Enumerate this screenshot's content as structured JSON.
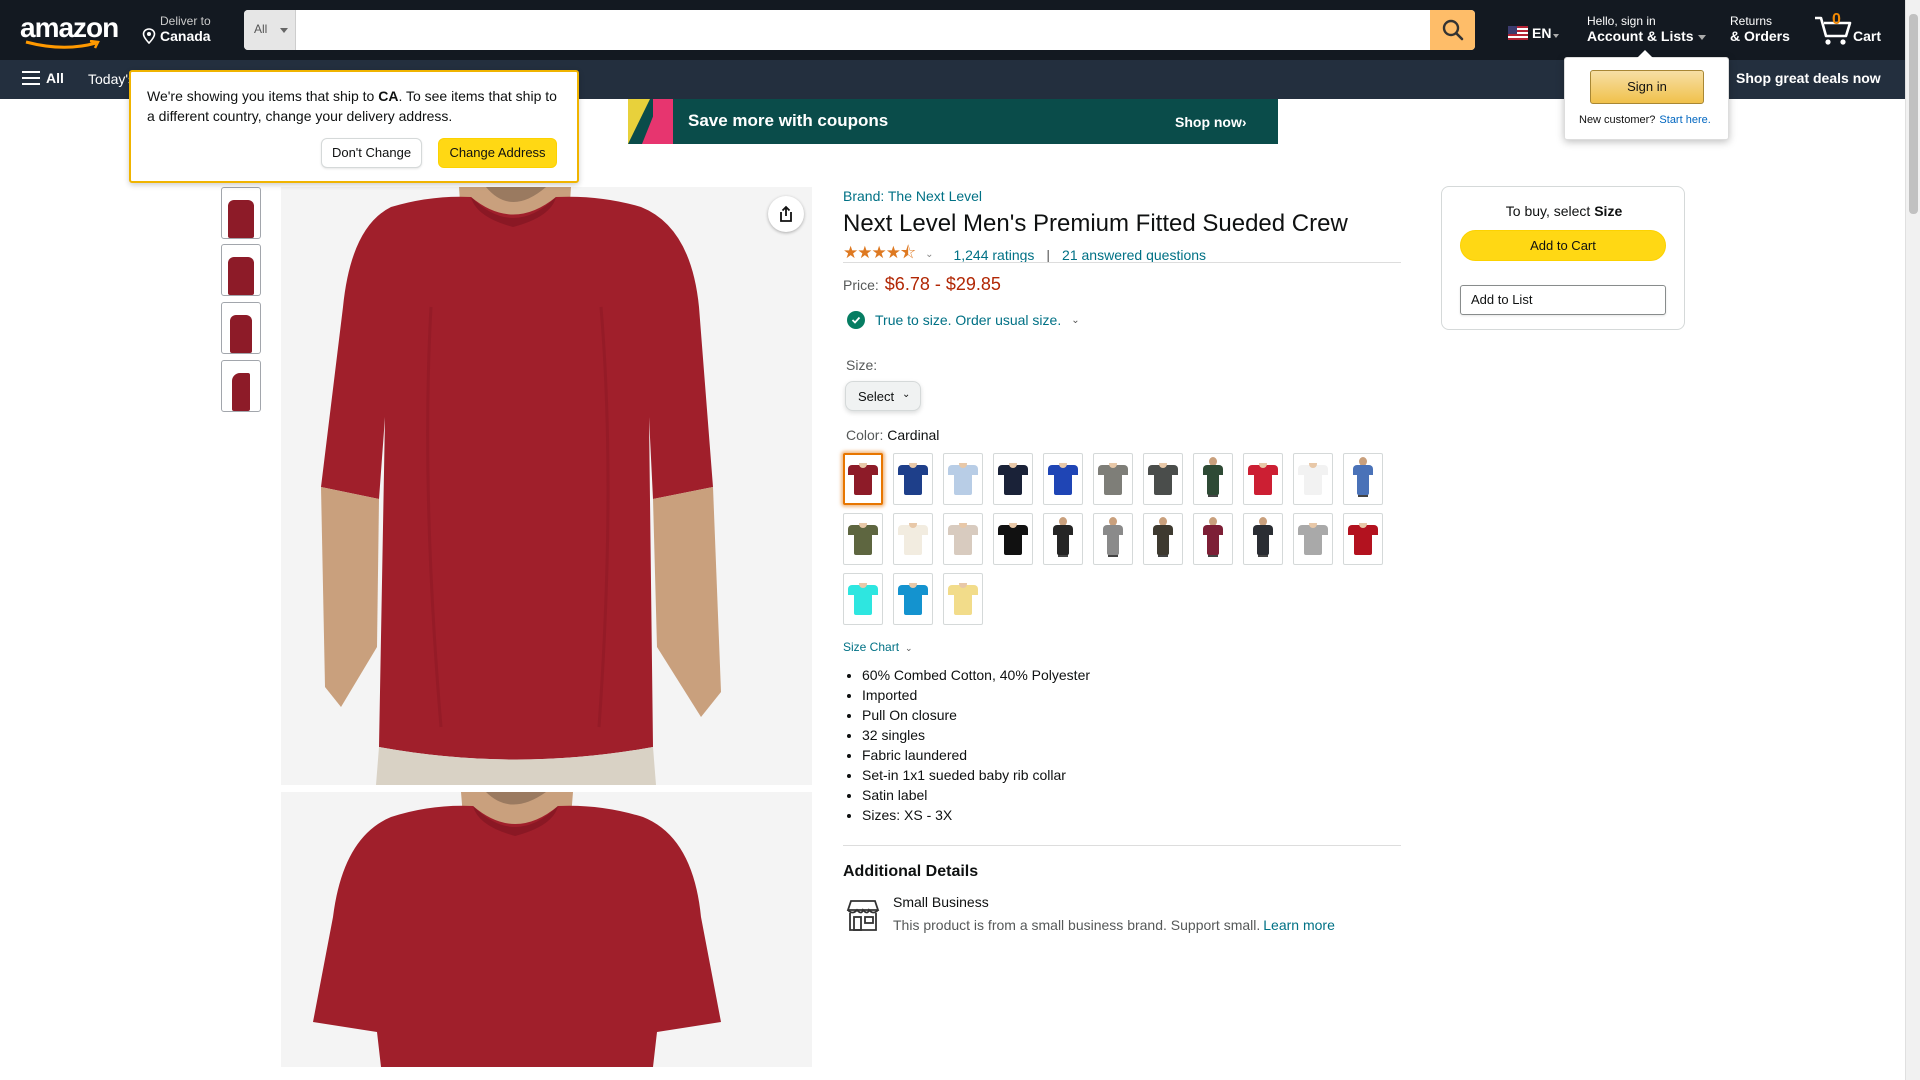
{
  "header": {
    "logo_text": "amazon",
    "deliver_line1": "Deliver to",
    "deliver_line2": "Canada",
    "search_category": "All",
    "search_placeholder": "",
    "language": "EN",
    "account_line1": "Hello, sign in",
    "account_line2": "Account & Lists",
    "returns_line1": "Returns",
    "returns_line2": "& Orders",
    "cart_count": "0",
    "cart_label": "Cart"
  },
  "subnav": {
    "all_label": "All",
    "todays_deals": "Today's",
    "promo": "Shop great deals now"
  },
  "address_popover": {
    "msg_before": "We're showing you items that ship to ",
    "country": "CA",
    "msg_after": ". To see items that ship to a different country, change your delivery address.",
    "dont_change": "Don't Change",
    "change_address": "Change Address"
  },
  "signin_popover": {
    "button": "Sign in",
    "new_customer": "New customer?",
    "start_here": "Start here."
  },
  "coupon_banner": {
    "text": "Save more with coupons",
    "cta": "Shop now›"
  },
  "product": {
    "brand": "Brand: The Next Level",
    "title": "Next Level Men's Premium Fitted Sueded Crew",
    "stars": "★★★★⯪",
    "rating_value": 4.5,
    "ratings": "1,244 ratings",
    "separator": "|",
    "questions": "21 answered questions",
    "price_label": "Price:",
    "price": "$6.78 - $29.85",
    "fit_text": "True to size. Order usual size.",
    "size_label": "Size:",
    "size_select": "Select",
    "color_label": "Color:",
    "color_value": "Cardinal",
    "size_chart": "Size Chart",
    "bullets": [
      "60% Combed Cotton, 40% Polyester",
      "Imported",
      "Pull On closure",
      "32 singles",
      "Fabric laundered",
      "Set-in 1x1 sueded baby rib collar",
      "Satin label",
      "Sizes: XS - 3X"
    ],
    "additional_details": "Additional Details",
    "small_business_title": "Small Business",
    "small_business_desc": "This product is from a small business brand. Support small.",
    "learn_more": "Learn more"
  },
  "swatches": [
    {
      "color": "#8d1b28",
      "style": "flat"
    },
    {
      "color": "#1e3f8a",
      "style": "flat"
    },
    {
      "color": "#b8cde6",
      "style": "flat"
    },
    {
      "color": "#1a2238",
      "style": "flat"
    },
    {
      "color": "#1f45b5",
      "style": "flat"
    },
    {
      "color": "#7e7e78",
      "style": "flat"
    },
    {
      "color": "#4a4d4b",
      "style": "flat"
    },
    {
      "color": "#2e4a35",
      "style": "model"
    },
    {
      "color": "#cc1f33",
      "style": "flat"
    },
    {
      "color": "#f2f2f2",
      "style": "flat"
    },
    {
      "color": "#4a72b8",
      "style": "model"
    },
    {
      "color": "#5e6640",
      "style": "flat"
    },
    {
      "color": "#f2ece0",
      "style": "flat"
    },
    {
      "color": "#d8cbbf",
      "style": "flat"
    },
    {
      "color": "#111111",
      "style": "flat"
    },
    {
      "color": "#252525",
      "style": "model"
    },
    {
      "color": "#8a8a8a",
      "style": "model"
    },
    {
      "color": "#3e3a30",
      "style": "model"
    },
    {
      "color": "#7d1f36",
      "style": "model"
    },
    {
      "color": "#2a2d33",
      "style": "model"
    },
    {
      "color": "#a9a9a9",
      "style": "flat"
    },
    {
      "color": "#b3121f",
      "style": "flat"
    },
    {
      "color": "#2ee6e0",
      "style": "flat"
    },
    {
      "color": "#1493cf",
      "style": "flat"
    },
    {
      "color": "#f2dc8a",
      "style": "flat"
    }
  ],
  "buybox": {
    "prompt": "To buy, select ",
    "prompt_bold": "Size",
    "add_to_cart": "Add to Cart",
    "add_to_list": "Add to List"
  },
  "colors": {
    "nav_bg": "#131921",
    "subnav_bg": "#232f3e",
    "link": "#007185",
    "price": "#b12704",
    "button_yellow": "#ffd814",
    "shirt": "#a01f2b"
  }
}
